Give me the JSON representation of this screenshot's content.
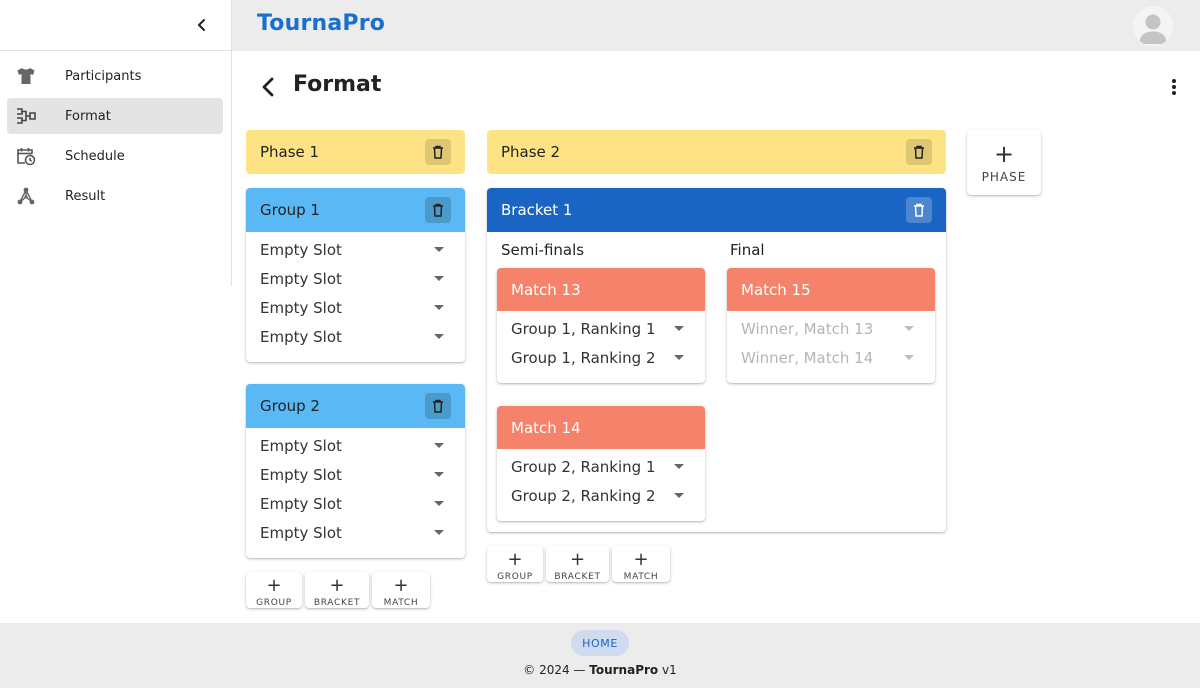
{
  "app": {
    "brand": "TournaPro"
  },
  "sidebar": {
    "items": [
      {
        "label": "Participants",
        "icon": "tshirt-icon"
      },
      {
        "label": "Format",
        "icon": "bracket-tree-icon",
        "active": true
      },
      {
        "label": "Schedule",
        "icon": "calendar-clock-icon"
      },
      {
        "label": "Result",
        "icon": "network-nodes-icon"
      }
    ]
  },
  "page": {
    "title": "Format"
  },
  "phases": [
    {
      "title": "Phase 1",
      "groups": [
        {
          "title": "Group 1",
          "slots": [
            "Empty Slot",
            "Empty Slot",
            "Empty Slot",
            "Empty Slot"
          ]
        },
        {
          "title": "Group 2",
          "slots": [
            "Empty Slot",
            "Empty Slot",
            "Empty Slot",
            "Empty Slot"
          ]
        }
      ],
      "add_buttons": [
        "GROUP",
        "BRACKET",
        "MATCH"
      ]
    },
    {
      "title": "Phase 2",
      "bracket": {
        "title": "Bracket 1",
        "rounds": [
          {
            "label": "Semi-finals",
            "matches": [
              {
                "title": "Match 13",
                "slots": [
                  "Group 1, Ranking 1",
                  "Group 1, Ranking 2"
                ]
              },
              {
                "title": "Match 14",
                "slots": [
                  "Group 2, Ranking 1",
                  "Group 2, Ranking 2"
                ]
              }
            ]
          },
          {
            "label": "Final",
            "matches": [
              {
                "title": "Match 15",
                "slots": [
                  "Winner, Match 13",
                  "Winner, Match 14"
                ],
                "disabled": true
              }
            ]
          }
        ]
      },
      "add_buttons": [
        "GROUP",
        "BRACKET",
        "MATCH"
      ]
    }
  ],
  "add_phase": {
    "plus": "+",
    "label": "PHASE"
  },
  "footer": {
    "home_label": "HOME",
    "copyright_prefix": "© 2024 — ",
    "copyright_brand": "TournaPro",
    "copyright_suffix": " v1"
  },
  "colors": {
    "brand": "#1a6fcc",
    "phase_header": "#fde383",
    "group_header": "#5ab8f4",
    "bracket_header": "#1a64c4",
    "match_header": "#f5836b",
    "active_nav": "#e4e4e4"
  }
}
